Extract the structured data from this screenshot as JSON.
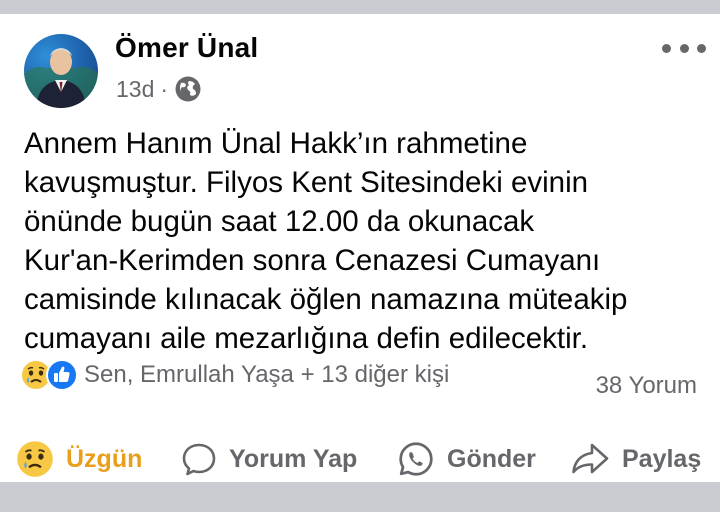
{
  "post": {
    "author": "Ömer Ünal",
    "time": "13d",
    "separator": "·",
    "visibility_icon": "globe-icon",
    "text_lines": [
      "Annem Hanım Ünal Hakk’ın rahmetine",
      "kavuşmuştur. Filyos Kent Sitesindeki evinin",
      "önünde bugün saat 12.00 da okunacak",
      "Kur'an-Kerimden sonra Cenazesi Cumayanı",
      "camisinde kılınacak öğlen namazına müteakip",
      "cumayanı aile mezarlığına defin edilecektir."
    ],
    "reactions": {
      "icons": [
        "sad-reaction-icon",
        "like-reaction-icon"
      ],
      "text": "Sen, Emrullah Yaşa + 13 diğer kişi"
    },
    "comments_count": "38 Yorum"
  },
  "actions": {
    "reaction_label": "Üzgün",
    "comment_label": "Yorum Yap",
    "send_label": "Gönder",
    "share_label": "Paylaş"
  },
  "colors": {
    "sad_reaction": "#e8a01c",
    "secondary_text": "#65676b",
    "like_blue": "#1877f2",
    "separator_band": "#c9ccd1"
  }
}
